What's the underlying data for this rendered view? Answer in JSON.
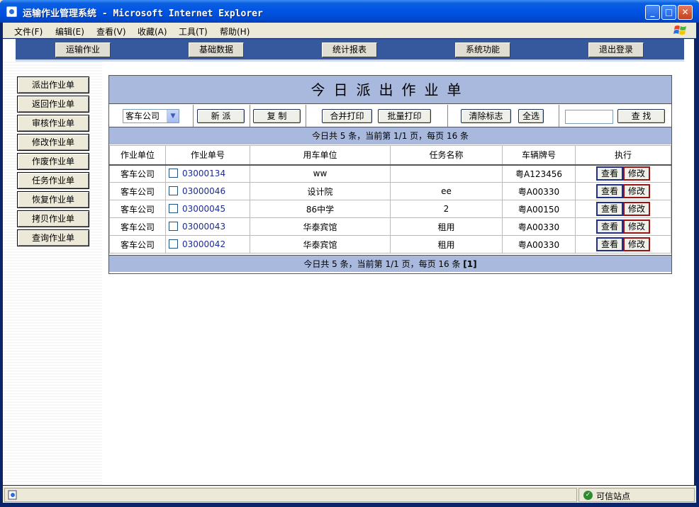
{
  "window": {
    "title": "运输作业管理系统 - Microsoft Internet Explorer",
    "minimize_icon": "minimize-icon",
    "maximize_icon": "maximize-icon",
    "close_icon": "close-icon"
  },
  "menu": {
    "items": [
      "文件(F)",
      "编辑(E)",
      "查看(V)",
      "收藏(A)",
      "工具(T)",
      "帮助(H)"
    ]
  },
  "topnav": {
    "items": [
      "运输作业",
      "基础数据",
      "统计报表",
      "系统功能",
      "退出登录"
    ]
  },
  "sidebar": {
    "items": [
      "派出作业单",
      "返回作业单",
      "审核作业单",
      "修改作业单",
      "作废作业单",
      "任务作业单",
      "恢复作业单",
      "拷贝作业单",
      "查询作业单"
    ]
  },
  "main": {
    "title": "今日派出作业单",
    "toolbar": {
      "company_select": "客车公司",
      "new_label": "新 派",
      "copy_label": "复 制",
      "merge_print_label": "合并打印",
      "batch_print_label": "批量打印",
      "clear_flag_label": "清除标志",
      "select_all_label": "全选",
      "search_value": "",
      "search_label": "查 找"
    },
    "info_top": "今日共 5 条，当前第 1/1 页，每页 16 条",
    "info_bottom": "今日共 5 条，当前第 1/1 页，每页 16 条",
    "info_bottom_pager": "[1]",
    "columns": [
      "作业单位",
      "作业单号",
      "用车单位",
      "任务名称",
      "车辆牌号",
      "执行"
    ],
    "rows": [
      {
        "unit": "客车公司",
        "no": "03000134",
        "user": "ww",
        "task": "",
        "plate": "粤A123456",
        "view": "查看",
        "edit": "修改"
      },
      {
        "unit": "客车公司",
        "no": "03000046",
        "user": "设计院",
        "task": "ee",
        "plate": "粤A00330",
        "view": "查看",
        "edit": "修改"
      },
      {
        "unit": "客车公司",
        "no": "03000045",
        "user": "86中学",
        "task": "2",
        "plate": "粤A00150",
        "view": "查看",
        "edit": "修改"
      },
      {
        "unit": "客车公司",
        "no": "03000043",
        "user": "华泰宾馆",
        "task": "租用",
        "plate": "粤A00330",
        "view": "查看",
        "edit": "修改"
      },
      {
        "unit": "客车公司",
        "no": "03000042",
        "user": "华泰宾馆",
        "task": "租用",
        "plate": "粤A00330",
        "view": "查看",
        "edit": "修改"
      }
    ]
  },
  "status": {
    "zone": "可信站点",
    "page_icon": "ie-page-icon",
    "zone_icon": "check-icon"
  }
}
